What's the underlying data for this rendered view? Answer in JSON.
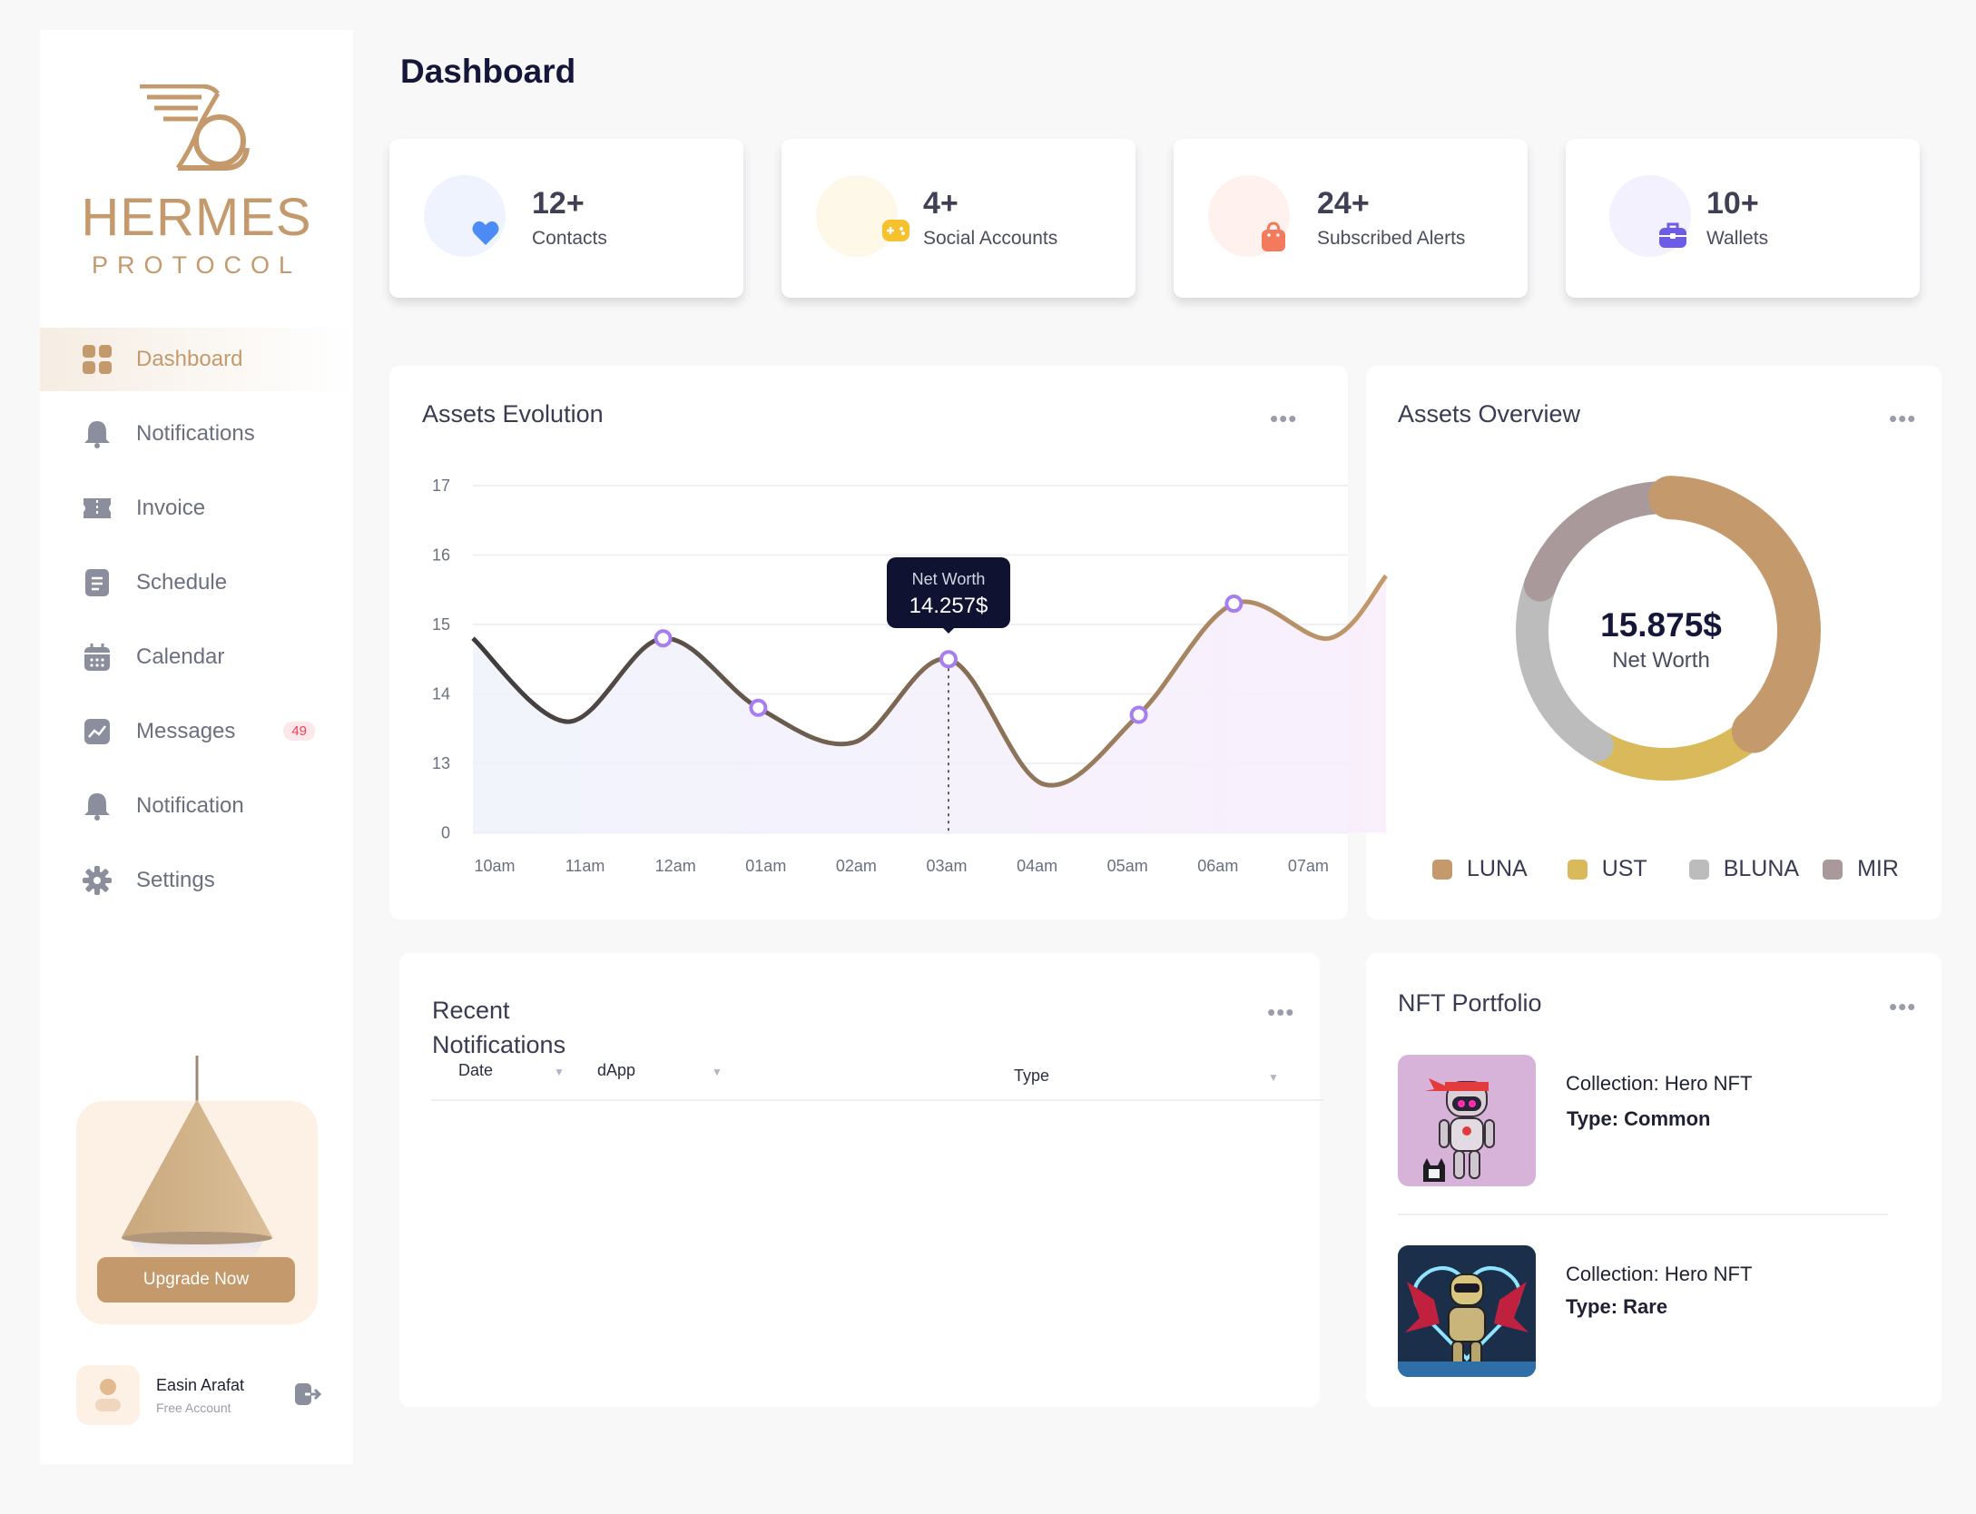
{
  "brand": {
    "name": "HERMES",
    "subtitle": "PROTOCOL",
    "color": "#c49a6c"
  },
  "sidebar": {
    "items": [
      {
        "label": "Dashboard",
        "icon": "grid-icon",
        "active": true
      },
      {
        "label": "Notifications",
        "icon": "bell-icon"
      },
      {
        "label": "Invoice",
        "icon": "ticket-icon"
      },
      {
        "label": "Schedule",
        "icon": "document-icon"
      },
      {
        "label": "Calendar",
        "icon": "calendar-icon"
      },
      {
        "label": "Messages",
        "icon": "chart-line-icon",
        "badge": "49"
      },
      {
        "label": "Notification",
        "icon": "bell-icon"
      },
      {
        "label": "Settings",
        "icon": "gear-icon"
      }
    ],
    "upgrade_label": "Upgrade Now",
    "user": {
      "name": "Easin Arafat",
      "plan": "Free Account"
    }
  },
  "page": {
    "title": "Dashboard"
  },
  "stats": [
    {
      "value": "12+",
      "label": "Contacts",
      "icon": "heart-icon",
      "color": "#4c8bf5",
      "bg": "#eef3fd"
    },
    {
      "value": "4+",
      "label": "Social Accounts",
      "icon": "game-controller-icon",
      "color": "#f7c12e",
      "bg": "#fef8e8"
    },
    {
      "value": "24+",
      "label": "Subscribed Alerts",
      "icon": "shopping-bag-icon",
      "color": "#f47a5e",
      "bg": "#fff1ee"
    },
    {
      "value": "10+",
      "label": "Wallets",
      "icon": "briefcase-icon",
      "color": "#6c5ce7",
      "bg": "#f2f1fd"
    }
  ],
  "assets_evolution": {
    "title": "Assets Evolution",
    "tooltip_label": "Net Worth",
    "tooltip_value": "14.257$"
  },
  "assets_overview": {
    "title": "Assets Overview",
    "center_value": "15.875$",
    "center_label": "Net Worth"
  },
  "recent_notifications": {
    "title_line1": "Recent",
    "title_line2": "Notifications",
    "columns": [
      "Date",
      "dApp",
      "Type"
    ]
  },
  "nft_portfolio": {
    "title": "NFT Portfolio",
    "items": [
      {
        "collection": "Collection: Hero NFT",
        "type": "Type: Common"
      },
      {
        "collection": "Collection: Hero NFT",
        "type": "Type: Rare"
      }
    ]
  },
  "chart_data": [
    {
      "type": "line",
      "title": "Assets Evolution",
      "x": [
        "10am",
        "11am",
        "12am",
        "01am",
        "02am",
        "03am",
        "04am",
        "05am",
        "06am",
        "07am"
      ],
      "y_ticks": [
        "0",
        "13",
        "14",
        "15",
        "16",
        "17"
      ],
      "series": [
        {
          "values": [
            14.8,
            13.6,
            14.8,
            13.8,
            13.3,
            14.5,
            12.7,
            13.7,
            15.3,
            14.8,
            15.7
          ]
        }
      ],
      "x_points": [
        0,
        1,
        2,
        3,
        4,
        5,
        6,
        7,
        8,
        9,
        9.6
      ],
      "markers": [
        2,
        3,
        5,
        7,
        8
      ],
      "tooltip": {
        "index": 5,
        "label": "Net Worth",
        "value": "14.257$"
      },
      "grid": true
    },
    {
      "type": "pie",
      "title": "Assets Overview",
      "categories": [
        "LUNA",
        "UST",
        "BLUNA",
        "MIR"
      ],
      "values": [
        38,
        20,
        22,
        20
      ],
      "colors": [
        "#c49a6c",
        "#d9b95a",
        "#bcbcbc",
        "#a9999a"
      ],
      "legend": "bottom"
    }
  ]
}
